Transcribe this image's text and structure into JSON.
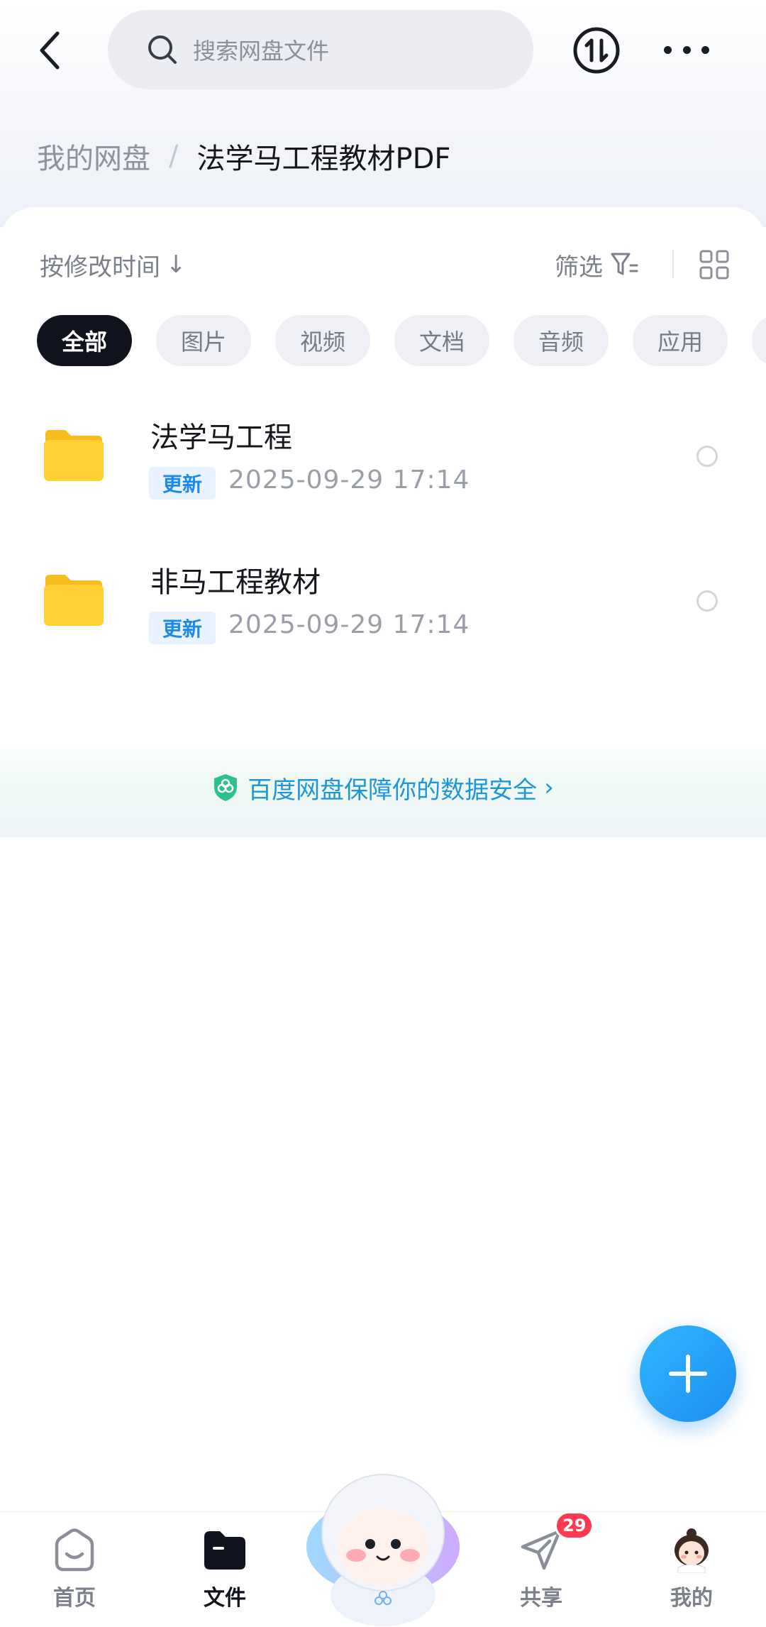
{
  "header": {
    "search_placeholder": "搜索网盘文件"
  },
  "breadcrumb": {
    "root": "我的网盘",
    "separator": "/",
    "current": "法学马工程教材PDF"
  },
  "toolbar": {
    "sort_label": "按修改时间",
    "sort_arrow": "↓",
    "filter_label": "筛选"
  },
  "chips": [
    "全部",
    "图片",
    "视频",
    "文档",
    "音频",
    "应用"
  ],
  "active_chip": "全部",
  "files": [
    {
      "name": "法学马工程",
      "badge": "更新",
      "modified": "2025-09-29  17:14",
      "type_icon": "folder-icon"
    },
    {
      "name": "非马工程教材",
      "badge": "更新",
      "modified": "2025-09-29  17:14",
      "type_icon": "folder-icon"
    }
  ],
  "security_banner": {
    "text": "百度网盘保障你的数据安全",
    "chevron": "›"
  },
  "tabbar": {
    "items": [
      {
        "label": "首页",
        "icon": "home-icon"
      },
      {
        "label": "文件",
        "icon": "files-icon",
        "active": true
      },
      {
        "label": "",
        "icon": "mascot-icon"
      },
      {
        "label": "共享",
        "icon": "share-icon",
        "badge": "29"
      },
      {
        "label": "我的",
        "icon": "avatar-icon"
      }
    ]
  },
  "colors": {
    "accent": "#1d8ef0",
    "badge_red": "#ff3a50",
    "update_badge_text": "#1d8ae8",
    "chip_active_bg": "#10131d"
  }
}
